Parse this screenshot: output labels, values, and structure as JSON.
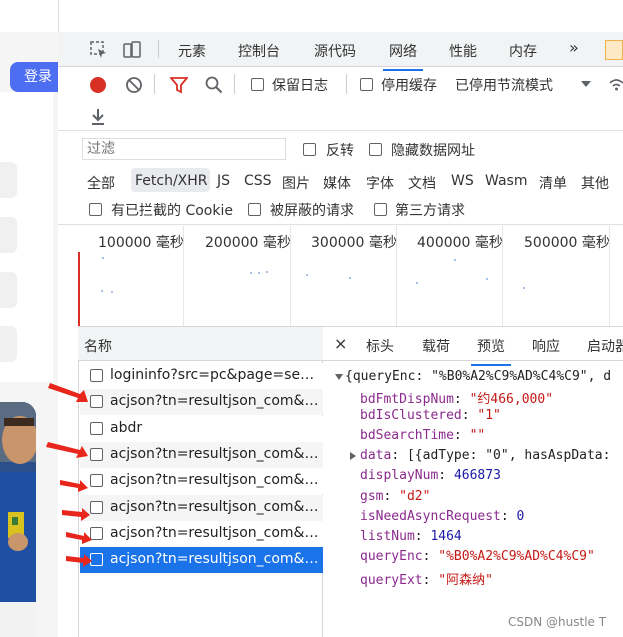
{
  "page": {
    "login_label": "登录"
  },
  "devtools": {
    "tabs": [
      "元素",
      "控制台",
      "源代码",
      "网络",
      "性能",
      "内存"
    ],
    "active_tab": "网络",
    "more_tabs": "»",
    "toolbar": {
      "preserve_log": "保留日志",
      "disable_cache": "停用缓存",
      "throttling": "已停用节流模式"
    },
    "filter": {
      "placeholder": "过滤",
      "invert": "反转",
      "hide_data_urls": "隐藏数据网址",
      "types": [
        "全部",
        "Fetch/XHR",
        "JS",
        "CSS",
        "图片",
        "媒体",
        "字体",
        "文档",
        "WS",
        "Wasm",
        "清单",
        "其他"
      ],
      "active_type": "Fetch/XHR",
      "blocked_cookies": "有已拦截的 Cookie",
      "blocked_requests": "被屏蔽的请求",
      "third_party": "第三方请求"
    },
    "timeline_ticks": [
      "100000 毫秒",
      "200000 毫秒",
      "300000 毫秒",
      "400000 毫秒",
      "500000 毫秒"
    ],
    "request_list": {
      "header": "名称",
      "rows": [
        {
          "name": "logininfo?src=pc&page=sear...",
          "selected": false
        },
        {
          "name": "acjson?tn=resultjson_com&l...",
          "selected": false
        },
        {
          "name": "abdr",
          "selected": false
        },
        {
          "name": "acjson?tn=resultjson_com&l...",
          "selected": false
        },
        {
          "name": "acjson?tn=resultjson_com&l...",
          "selected": false
        },
        {
          "name": "acjson?tn=resultjson_com&l...",
          "selected": false
        },
        {
          "name": "acjson?tn=resultjson_com&l...",
          "selected": false
        },
        {
          "name": "acjson?tn=resultjson_com&l...",
          "selected": true
        }
      ]
    },
    "panel_tabs": [
      "标头",
      "载荷",
      "预览",
      "响应",
      "启动器"
    ],
    "active_panel_tab": "预览",
    "close_glyph": "×",
    "preview": {
      "summary": "{queryEnc: \"%B0%A2%C9%AD%C4%C9\", d",
      "fields": [
        {
          "key": "bdFmtDispNum",
          "value": "\"约466,000\"",
          "kind": "string"
        },
        {
          "key": "bdIsClustered",
          "value": "\"1\"",
          "kind": "string"
        },
        {
          "key": "bdSearchTime",
          "value": "\"\"",
          "kind": "string"
        },
        {
          "key": "data",
          "value": "[{adType: \"0\", hasAspData:",
          "kind": "plain",
          "expandable": true
        },
        {
          "key": "displayNum",
          "value": "466873",
          "kind": "number"
        },
        {
          "key": "gsm",
          "value": "\"d2\"",
          "kind": "string"
        },
        {
          "key": "isNeedAsyncRequest",
          "value": "0",
          "kind": "number"
        },
        {
          "key": "listNum",
          "value": "1464",
          "kind": "number"
        },
        {
          "key": "queryEnc",
          "value": "\"%B0%A2%C9%AD%C4%C9\"",
          "kind": "string"
        },
        {
          "key": "queryExt",
          "value": "\"阿森纳\"",
          "kind": "string"
        }
      ]
    },
    "watermark": "CSDN @hustle T"
  },
  "colors": {
    "accent": "#1a73e8",
    "record": "#d93025",
    "selected_row": "#1a73e8",
    "arrow": "#e8261c",
    "login": "#4e6ef2"
  }
}
